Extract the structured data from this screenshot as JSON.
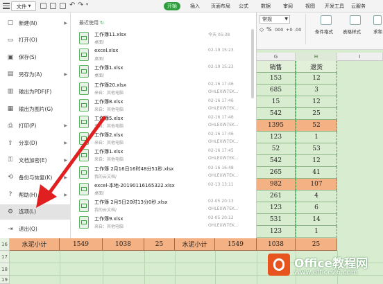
{
  "tabbar": {
    "file_label": "文件",
    "tabs": [
      "开始",
      "插入",
      "页面布局",
      "公式",
      "数据",
      "审阅",
      "视图",
      "开发工具",
      "云服务"
    ]
  },
  "ribbon": {
    "number_format": "常规",
    "percent": "%",
    "thousands": "000",
    "inc_decimal": "+0",
    "dec_decimal": ".00",
    "conditional_format": "条件格式",
    "table_style": "表格样式",
    "sum": "求和"
  },
  "sheet": {
    "col_g": "G",
    "col_h": "H",
    "col_i": "I",
    "rows": [
      {
        "g": "销售",
        "h": "退货",
        "highlight": false
      },
      {
        "g": "153",
        "h": "12",
        "highlight": false
      },
      {
        "g": "685",
        "h": "3",
        "highlight": false
      },
      {
        "g": "15",
        "h": "12",
        "highlight": false
      },
      {
        "g": "542",
        "h": "25",
        "highlight": false
      },
      {
        "g": "1395",
        "h": "52",
        "highlight": true
      },
      {
        "g": "123",
        "h": "1",
        "highlight": false
      },
      {
        "g": "52",
        "h": "53",
        "highlight": false
      },
      {
        "g": "542",
        "h": "12",
        "highlight": false
      },
      {
        "g": "265",
        "h": "41",
        "highlight": false
      },
      {
        "g": "982",
        "h": "107",
        "highlight": true
      },
      {
        "g": "261",
        "h": "4",
        "highlight": false
      },
      {
        "g": "123",
        "h": "6",
        "highlight": false
      },
      {
        "g": "531",
        "h": "14",
        "highlight": false
      },
      {
        "g": "123",
        "h": "1",
        "highlight": false
      }
    ],
    "row16": {
      "num": "16",
      "cells": [
        "水泥小计",
        "1549",
        "1038",
        "25",
        "水泥小计",
        "1549",
        "1038",
        "25"
      ]
    },
    "row17": "17",
    "row18": "18",
    "row19": "19"
  },
  "filemenu": {
    "items": [
      {
        "label": "新建(N)",
        "icon": "new-icon",
        "has_arrow": true
      },
      {
        "label": "打开(O)",
        "icon": "open-icon",
        "has_arrow": false
      },
      {
        "label": "保存(S)",
        "icon": "save-icon",
        "has_arrow": false
      },
      {
        "label": "另存为(A)",
        "icon": "save-as-icon",
        "has_arrow": true
      },
      {
        "label": "输出为PDF(F)",
        "icon": "pdf-icon",
        "has_arrow": false
      },
      {
        "label": "输出为图片(G)",
        "icon": "image-icon",
        "has_arrow": false
      },
      {
        "label": "打印(P)",
        "icon": "print-icon",
        "has_arrow": true
      },
      {
        "label": "分享(D)",
        "icon": "share-icon",
        "has_arrow": true
      },
      {
        "label": "文档加密(E)",
        "icon": "lock-icon",
        "has_arrow": true
      },
      {
        "label": "备份与恢复(K)",
        "icon": "backup-icon",
        "has_arrow": true
      },
      {
        "label": "帮助(H)",
        "icon": "help-icon",
        "has_arrow": true
      },
      {
        "label": "选项(L)",
        "icon": "gear-icon",
        "has_arrow": false,
        "active": true
      },
      {
        "label": "退出(Q)",
        "icon": "exit-icon",
        "has_arrow": false
      }
    ]
  },
  "recent": {
    "title": "最近使用",
    "files": [
      {
        "name": "工作簿11.xlsx",
        "loc": "桌面/",
        "time": "今天 05:38",
        "dev": ""
      },
      {
        "name": "excel.xlsx",
        "loc": "桌面/",
        "time": "02-19 15:23",
        "dev": ""
      },
      {
        "name": "工作簿1.xlsx",
        "loc": "桌面/",
        "time": "02-19 15:23",
        "dev": ""
      },
      {
        "name": "工作簿20.xlsx",
        "loc": "来自：其他电脑",
        "time": "02-16 17:46",
        "dev": "OHLEXW7EK..."
      },
      {
        "name": "工作簿8.xlsx",
        "loc": "来自：其他电脑",
        "time": "02-16 17:46",
        "dev": "OHLEXW7EK..."
      },
      {
        "name": "工作簿5.xlsx",
        "loc": "来自：其他电脑",
        "time": "02-16 17:46",
        "dev": "OHLEXW7EK..."
      },
      {
        "name": "工作簿2.xlsx",
        "loc": "来自：其他电脑",
        "time": "02-16 17:46",
        "dev": "OHLEXW7EK..."
      },
      {
        "name": "工作簿1.xlsx",
        "loc": "来自：其他电脑",
        "time": "02-16 17:45",
        "dev": "OHLEXW7EK..."
      },
      {
        "name": "工作簿 2月16日16时48分51秒.xlsx",
        "loc": "我的云文档/",
        "time": "02-16 16:48",
        "dev": "OHLEXW7EK..."
      },
      {
        "name": "excel-本地-20190116165322.xlsx",
        "loc": "桌面/",
        "time": "02-13 13:11",
        "dev": ""
      },
      {
        "name": "工作簿 2月5日20时13分0秒.xlsx",
        "loc": "我的云文档/",
        "time": "02-05 20:13",
        "dev": "OHLEXW7EK..."
      },
      {
        "name": "工作簿9.xlsx",
        "loc": "来自：其他电脑",
        "time": "02-05 20:12",
        "dev": "OHLEXW7EK..."
      }
    ]
  },
  "watermark": {
    "title": "Office教程网",
    "url": "www.office26.com"
  },
  "colors": {
    "accent_green": "#2e9e3e",
    "highlight_orange": "#f4b183",
    "sheet_bg": "#d8ecd0",
    "annotation_red": "#e02020"
  }
}
